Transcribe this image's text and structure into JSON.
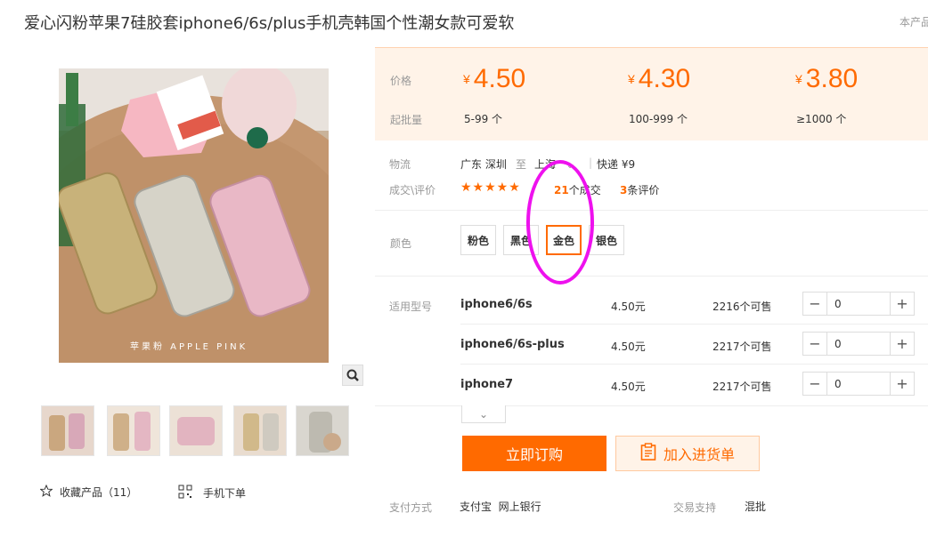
{
  "header": {
    "title": "爱心闪粉苹果7硅胶套iphone6/6s/plus手机壳韩国个性潮女款可爱软",
    "right_text": "本产品"
  },
  "gallery": {
    "main_image_caption": "苹果粉 APPLE PINK",
    "thumbnail_count": 5
  },
  "actions": {
    "favorite_label": "收藏产品（11）",
    "mobile_order_label": "手机下单"
  },
  "pricing": {
    "price_label": "价格",
    "min_batch_label": "起批量",
    "currency": "¥",
    "tiers": [
      {
        "price": "4.50",
        "range": "5-99 个"
      },
      {
        "price": "4.30",
        "range": "100-999 个"
      },
      {
        "price": "3.80",
        "range": "≥1000 个"
      }
    ]
  },
  "logistics": {
    "label": "物流",
    "from": "广东 深圳",
    "to_word": "至",
    "to": "上海",
    "express": "快递 ¥9"
  },
  "deals": {
    "label": "成交\\评价",
    "stars": "★★★★★",
    "deal_count": "21",
    "deal_suffix": "个成交",
    "review_count": "3",
    "review_suffix": "条评价"
  },
  "colors": {
    "label": "颜色",
    "options": [
      "粉色",
      "黑色",
      "金色",
      "银色"
    ],
    "selected": "金色"
  },
  "models": {
    "label": "适用型号",
    "rows": [
      {
        "name": "iphone6/6s",
        "price": "4.50元",
        "stock": "2216个可售",
        "qty": "0"
      },
      {
        "name": "iphone6/6s-plus",
        "price": "4.50元",
        "stock": "2217个可售",
        "qty": "0"
      },
      {
        "name": "iphone7",
        "price": "4.50元",
        "stock": "2217个可售",
        "qty": "0"
      }
    ]
  },
  "buttons": {
    "buy": "立即订购",
    "cart": "加入进货单"
  },
  "payment": {
    "label": "支付方式",
    "methods": "支付宝  网上银行",
    "support_label": "交易支持",
    "support_value": "混批"
  },
  "theme": {
    "accent": "#ff6a00",
    "annotation": "#ee11ee"
  }
}
